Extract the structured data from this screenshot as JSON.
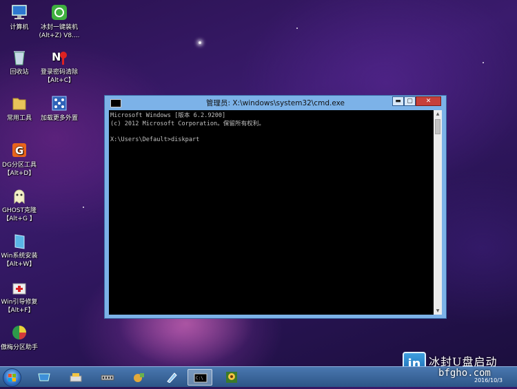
{
  "desktop": {
    "icons": [
      {
        "label1": "计算机",
        "label2": "",
        "icon": "computer-icon"
      },
      {
        "label1": "冰封一键装机",
        "label2": "(Alt+Z) V8....",
        "icon": "installer-icon"
      },
      {
        "label1": "回收站",
        "label2": "",
        "icon": "recycle-bin-icon"
      },
      {
        "label1": "登录密码清除",
        "label2": "【Alt+C】",
        "icon": "password-clear-icon"
      },
      {
        "label1": "常用工具",
        "label2": "",
        "icon": "folder-icon"
      },
      {
        "label1": "加载更多外置",
        "label2": "",
        "icon": "load-external-icon"
      },
      {
        "label1": "DG分区工具",
        "label2": "【Alt+D】",
        "icon": "diskgenius-icon"
      },
      {
        "label1": "GHOST克隆",
        "label2": "【Alt+G 】",
        "icon": "ghost-icon"
      },
      {
        "label1": "Win系统安装",
        "label2": "【Alt+W】",
        "icon": "win-install-icon"
      },
      {
        "label1": "Win引导修复",
        "label2": "【Alt+F】",
        "icon": "boot-repair-icon"
      },
      {
        "label1": "傲梅分区助手",
        "label2": "",
        "icon": "aomei-partition-icon"
      }
    ]
  },
  "window": {
    "title": "管理员: X:\\windows\\system32\\cmd.exe",
    "buttons": {
      "minimize": "▬",
      "maximize": "▢",
      "close": "✕"
    },
    "console_text": "Microsoft Windows [版本 6.2.9200]\n(c) 2012 Microsoft Corporation。保留所有权利。\n\nX:\\Users\\Default>diskpart"
  },
  "taskbar": {
    "items": [
      "network-icon",
      "printer-tools-icon",
      "ram-disk-icon",
      "tools-icon",
      "pen-icon",
      "cmd-icon",
      "sunflower-icon"
    ],
    "active_item": "cmd-icon",
    "clock_date": "2016/10/3"
  },
  "watermark": {
    "logo_text": "in",
    "text": "冰封U盘启动",
    "domain": "bfgho.com"
  },
  "colors": {
    "title_bar": "#7cb2e8",
    "console_bg": "#000000",
    "console_fg": "#c0c0c0",
    "close_button": "#c7403a",
    "taskbar": "#3a66a0"
  }
}
